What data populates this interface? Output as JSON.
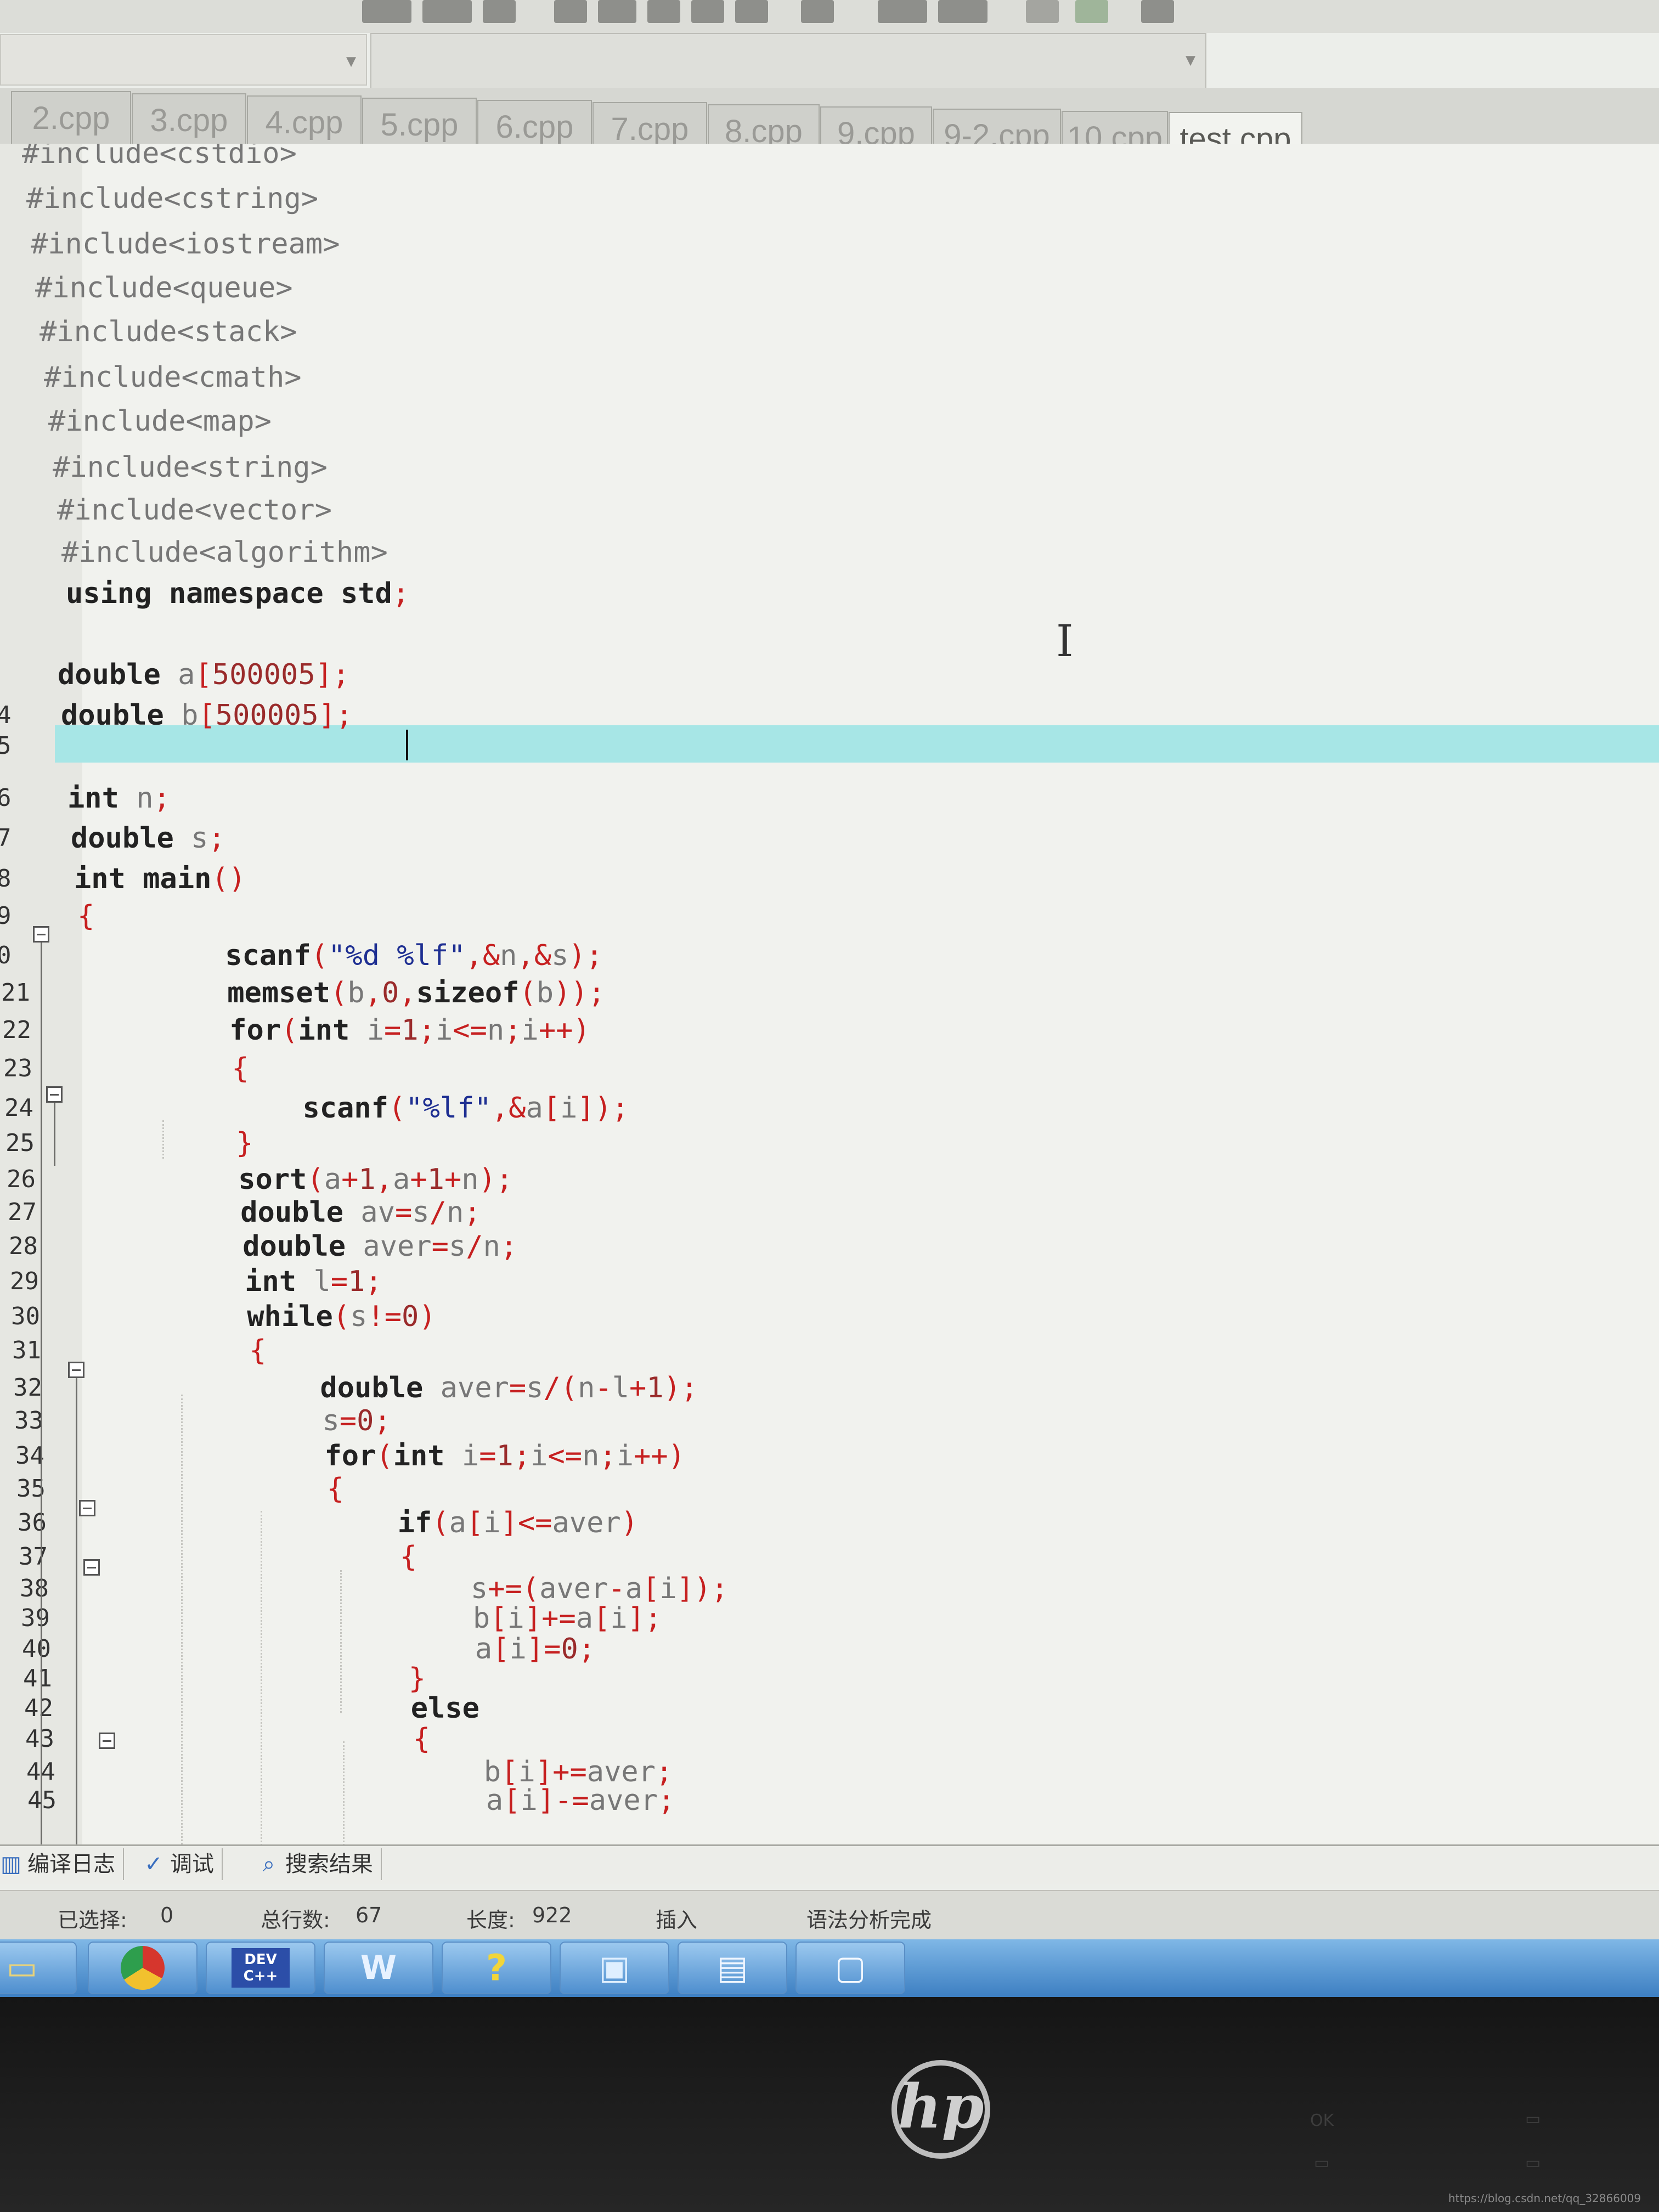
{
  "file_tabs": [
    "2.cpp",
    "3.cpp",
    "4.cpp",
    "5.cpp",
    "6.cpp",
    "7.cpp",
    "8.cpp",
    "9.cpp",
    "9-2.cpp",
    "10.cpp",
    "test.cpp"
  ],
  "active_tab": "test.cpp",
  "gutter_numbers": [
    "",
    "",
    "",
    "",
    "",
    "",
    "",
    "",
    "",
    "",
    "",
    "",
    "",
    "4",
    "5",
    "6",
    "7",
    "8",
    "9",
    "0",
    "21",
    "22",
    "23",
    "24",
    "25",
    "26",
    "27",
    "28",
    "29",
    "30",
    "31",
    "32",
    "33",
    "34",
    "35",
    "36",
    "37",
    "38",
    "39",
    "40",
    "41",
    "42",
    "43",
    "44",
    "45"
  ],
  "code_lines": [
    "#include<cstdio>",
    "#include<cstring>",
    "#include<iostream>",
    "#include<queue>",
    "#include<stack>",
    "#include<cmath>",
    "#include<map>",
    "#include<string>",
    "#include<vector>",
    "#include<algorithm>",
    "using namespace std;",
    "",
    "double a[500005];",
    "double b[500005];",
    "",
    "int n;",
    "double s;",
    "int main()",
    "{",
    "    scanf(\"%d %lf\",&n,&s);",
    "    memset(b,0,sizeof(b));",
    "    for(int i=1;i<=n;i++)",
    "    {",
    "        scanf(\"%lf\",&a[i]);",
    "    }",
    "    sort(a+1,a+1+n);",
    "    double av=s/n;",
    "    double aver=s/n;",
    "    int l=1;",
    "    while(s!=0)",
    "    {",
    "        double aver=s/(n-l+1);",
    "        s=0;",
    "        for(int i=1;i<=n;i++)",
    "        {",
    "            if(a[i]<=aver)",
    "            {",
    "                s+=(aver-a[i]);",
    "                b[i]+=a[i];",
    "                a[i]=0;",
    "            }",
    "            else",
    "            {",
    "                b[i]+=aver;",
    "                a[i]-=aver;"
  ],
  "bottom_tabs": [
    {
      "label": "编译日志",
      "icon": "chart-icon"
    },
    {
      "label": "调试",
      "icon": "check-icon"
    },
    {
      "label": "搜索结果",
      "icon": "search-icon"
    }
  ],
  "status": {
    "selected_label": "已选择:",
    "selected_value": "0",
    "total_lines_label": "总行数:",
    "total_lines_value": "67",
    "length_label": "长度:",
    "length_value": "922",
    "mode": "插入",
    "message": "语法分析完成"
  },
  "taskbar_apps": [
    "folder-icon",
    "chrome-icon",
    "devcpp-icon",
    "wps-icon",
    "help-icon",
    "image-viewer-icon",
    "notepad-icon",
    "window-icon"
  ],
  "devcpp_text": "DEV C++",
  "bezel": {
    "brand": "hp",
    "ok": "OK"
  },
  "watermark": "https://blog.csdn.net/qq_32866009",
  "colors": {
    "highlight_line": "#a7e6e6",
    "taskbar": "#4f8fcf",
    "keyword": "#222222",
    "number": "#9a2b2b",
    "string": "#1e2f92"
  }
}
